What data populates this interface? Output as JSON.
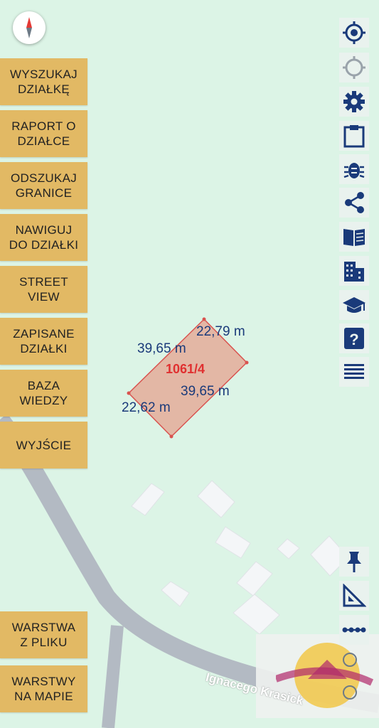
{
  "menu": {
    "items": [
      {
        "label": "WYSZUKAJ\nDZIAŁKĘ"
      },
      {
        "label": "RAPORT O\nDZIAŁCE"
      },
      {
        "label": "ODSZUKAJ\nGRANICE"
      },
      {
        "label": "NAWIGUJ\nDO DZIAŁKI"
      },
      {
        "label": "STREET\nVIEW"
      },
      {
        "label": "ZAPISANE\nDZIAŁKI"
      },
      {
        "label": "BAZA\nWIEDZY"
      },
      {
        "label": "WYJŚCIE"
      }
    ],
    "layers": [
      {
        "label": "WARSTWA\nZ PLIKU"
      },
      {
        "label": "WARSTWY\nNA MAPIE"
      }
    ]
  },
  "tools": [
    "gps-target-icon",
    "crosshair-icon",
    "gear-icon",
    "clipboard-icon",
    "bug-icon",
    "share-icon",
    "book-icon",
    "building-icon",
    "graduation-cap-icon",
    "help-icon",
    "menu-icon",
    "pin-icon",
    "ruler-icon",
    "measure-line-icon"
  ],
  "parcel": {
    "id": "1061/4",
    "edges": [
      "22,79 m",
      "39,65 m",
      "39,65 m",
      "22,62 m"
    ]
  },
  "map": {
    "street": "Ignacego Krasick"
  },
  "colors": {
    "button": "#e2b964",
    "map_bg": "#dcf4e6",
    "parcel_fill": "#e3b7a5",
    "parcel_stroke": "#d9534f",
    "icon": "#1a3a7a"
  }
}
